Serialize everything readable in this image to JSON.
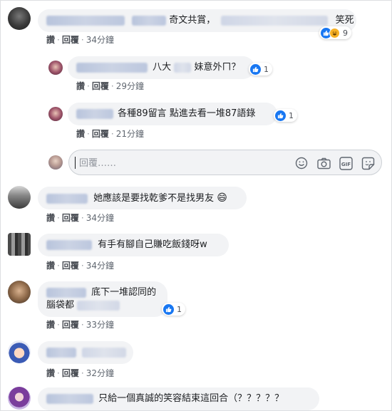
{
  "comments": [
    {
      "text_before": "奇文共賞，",
      "text_after": "笑死",
      "actions": {
        "like": "讚",
        "reply": "回覆",
        "time": "34分鐘"
      },
      "reaction_count": "9",
      "replies": [
        {
          "text": "八大",
          "text_tail": "妹意外ㄇ？",
          "actions": {
            "like": "讚",
            "reply": "回覆",
            "time": "29分鐘"
          },
          "reaction_count": "1"
        },
        {
          "text": "各種89留言 點進去看一堆87語錄",
          "actions": {
            "like": "讚",
            "reply": "回覆",
            "time": "21分鐘"
          },
          "reaction_count": "1"
        }
      ]
    },
    {
      "text": "她應該是要找乾爹不是找男友",
      "actions": {
        "like": "讚",
        "reply": "回覆",
        "time": "34分鐘"
      }
    },
    {
      "text": "有手有腳自己賺吃飯錢呀w",
      "actions": {
        "like": "讚",
        "reply": "回覆",
        "time": "34分鐘"
      }
    },
    {
      "text_line1": "底下一堆認同的",
      "text_line2": "腦袋都",
      "actions": {
        "like": "讚",
        "reply": "回覆",
        "time": "33分鐘"
      },
      "reaction_count": "1"
    },
    {
      "text": "",
      "actions": {
        "like": "讚",
        "reply": "回覆",
        "time": "32分鐘"
      }
    },
    {
      "text": "只給一個真誠的笑容結束這回合（？？？？？"
    }
  ],
  "reply_box": {
    "placeholder": "回覆……"
  },
  "icons": [
    "emoji-icon",
    "camera-icon",
    "gif-icon",
    "sticker-icon",
    "like-icon",
    "haha-icon",
    "grinning-emoji"
  ],
  "colors": {
    "bubble": "#f2f3f5",
    "like_blue": "#1877f2",
    "meta_gray": "#606770"
  }
}
